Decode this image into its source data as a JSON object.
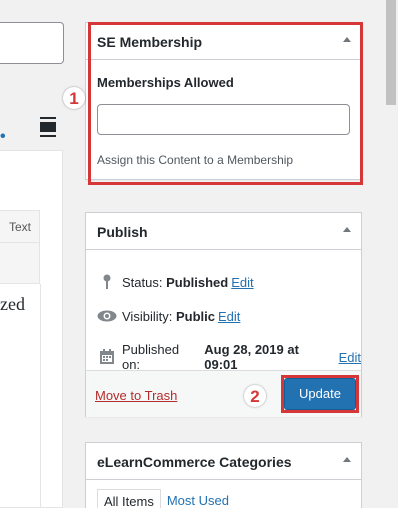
{
  "editor": {
    "text_tab": "Text",
    "content_fragment": "zed"
  },
  "membership_box": {
    "title": "SE Membership",
    "field_label": "Memberships Allowed",
    "field_value": "",
    "help_text": "Assign this Content to a Membership"
  },
  "publish_box": {
    "title": "Publish",
    "status_label": "Status:",
    "status_value": "Published",
    "visibility_label": "Visibility:",
    "visibility_value": "Public",
    "published_label": "Published on:",
    "published_value": "Aug 28, 2019 at 09:01",
    "edit_link": "Edit",
    "trash_link": "Move to Trash",
    "update_button": "Update"
  },
  "categories_box": {
    "title": "eLearnCommerce Categories",
    "tabs": [
      "All Items",
      "Most Used"
    ]
  },
  "annotations": {
    "step1": "1",
    "step2": "2"
  },
  "colors": {
    "accent": "#2271b1",
    "highlight": "#d63638",
    "trash": "#b32d2e"
  }
}
